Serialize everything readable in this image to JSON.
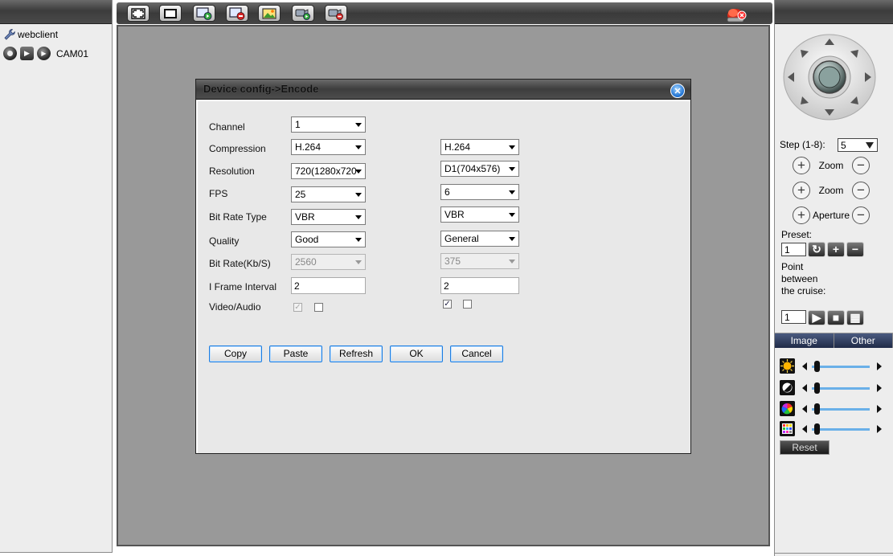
{
  "left_panel": {
    "root_label": "webclient",
    "camera_label": "CAM01"
  },
  "dialog": {
    "title": "Device config->Encode",
    "fields": {
      "channel": {
        "label": "Channel",
        "value": "1"
      },
      "compression": {
        "label": "Compression",
        "main": "H.264",
        "extra": "H.264"
      },
      "resolution": {
        "label": "Resolution",
        "main": "720(1280x720",
        "extra": "D1(704x576)"
      },
      "fps": {
        "label": "FPS",
        "main": "25",
        "extra": "6"
      },
      "bit_rate_type": {
        "label": "Bit Rate Type",
        "main": "VBR",
        "extra": "VBR"
      },
      "quality": {
        "label": "Quality",
        "main": "Good",
        "extra": "General"
      },
      "bit_rate": {
        "label": "Bit Rate(Kb/S)",
        "main": "2560",
        "extra": "375"
      },
      "i_frame_interval": {
        "label": "I Frame Interval",
        "main": "2",
        "extra": "2"
      },
      "video_audio": {
        "label": "Video/Audio"
      }
    },
    "buttons": {
      "copy": "Copy",
      "paste": "Paste",
      "refresh": "Refresh",
      "ok": "OK",
      "cancel": "Cancel"
    }
  },
  "ptz": {
    "step_label": "Step (1-8):",
    "step_value": "5",
    "zoom1": "Zoom",
    "zoom2": "Zoom",
    "aperture": "Aperture",
    "preset_label": "Preset:",
    "preset_value": "1",
    "cruise_label": "Point between the cruise:",
    "cruise_value": "1"
  },
  "image_panel": {
    "tab_image": "Image",
    "tab_other": "Other",
    "reset": "Reset"
  }
}
